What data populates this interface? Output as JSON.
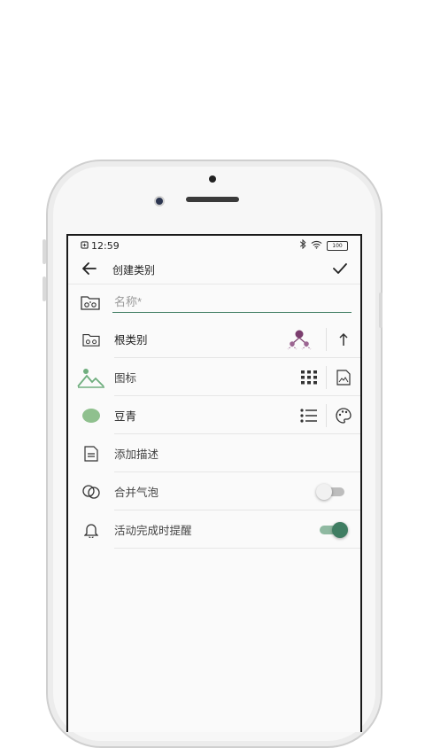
{
  "status_bar": {
    "time": "12:59",
    "battery": "100"
  },
  "app_bar": {
    "title": "创建类别"
  },
  "name_field": {
    "placeholder": "名称*",
    "value": ""
  },
  "rows": {
    "root_category": {
      "label": "根类别"
    },
    "icon": {
      "label": "图标"
    },
    "color": {
      "label": "豆青",
      "swatch_color": "#8fc08e"
    },
    "description": {
      "label": "添加描述"
    },
    "merge_bubbles": {
      "label": "合并气泡",
      "enabled": false
    },
    "activity_reminder": {
      "label": "活动完成时提醒",
      "enabled": true
    }
  },
  "colors": {
    "accent": "#3f7d62",
    "tree_icon": "#7b3e6e"
  }
}
